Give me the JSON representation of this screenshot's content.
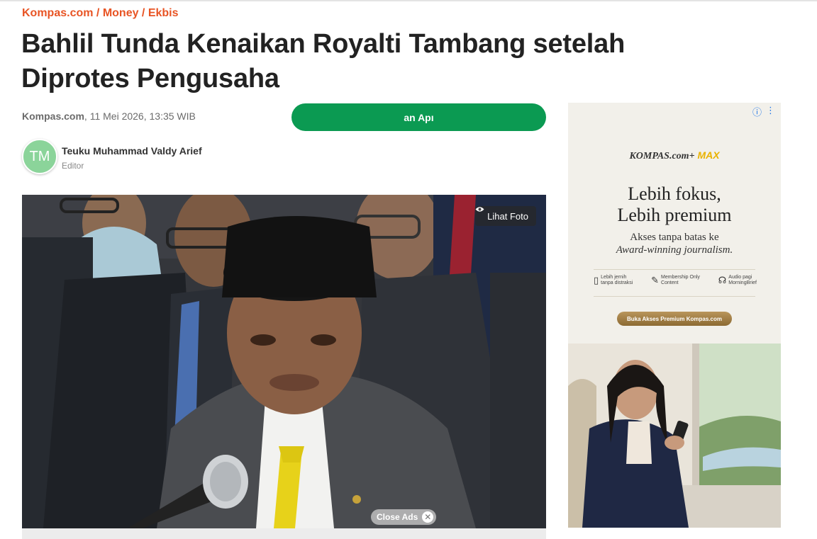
{
  "breadcrumb": {
    "site": "Kompas.com",
    "sep1": " / ",
    "section": "Money",
    "sep2": " / ",
    "subsection": "Ekbis"
  },
  "article": {
    "title": "Bahlil Tunda Kenaikan Royalti Tambang setelah Diprotes Pengusaha",
    "source": "Kompas.com",
    "datetime": ", 11 Mei 2026, 13:35 WIB"
  },
  "app_button": {
    "label": "an Apı"
  },
  "author": {
    "initials": "TM",
    "name": "Teuku Muhammad Valdy Arief",
    "role": "Editor"
  },
  "photo": {
    "lihat_foto": "Lihat Foto",
    "close_ads": "Close Ads",
    "close_icon": "eye-icon"
  },
  "ad": {
    "brand": "KOMPAS.com+",
    "brand_max": " MAX",
    "headline_1": "Lebih fokus,",
    "headline_2": "Lebih premium",
    "sub_1": "Akses tanpa batas ke",
    "sub_2": "Award-winning journalism.",
    "features": [
      {
        "line1": "Lebih jernih",
        "line2": "tanpa distraksi"
      },
      {
        "line1": "Membership Only",
        "line2": "Content"
      },
      {
        "line1": "Audio pagi",
        "line2": "MorningBrief"
      }
    ],
    "cta": "Buka Akses Premium Kompas.com",
    "accent_color": "#e9b200"
  },
  "colors": {
    "breadcrumb": "#e85424",
    "app_button": "#0b9a52",
    "avatar": "#8bd49a"
  }
}
